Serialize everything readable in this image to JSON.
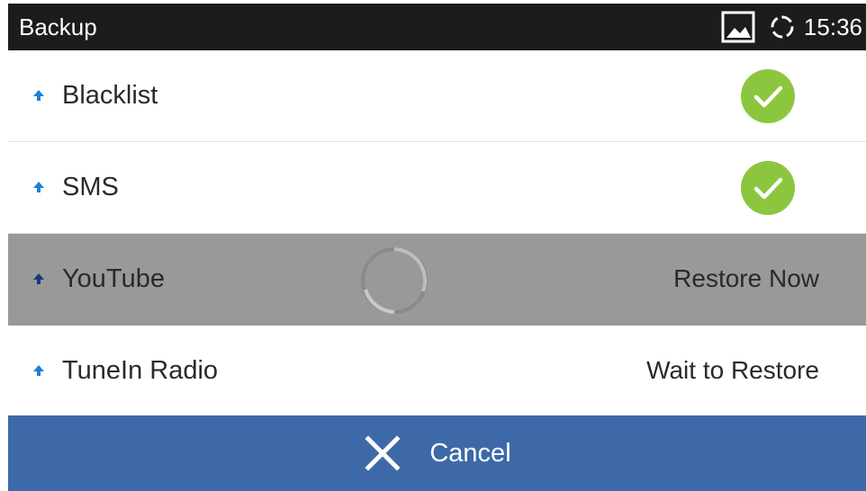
{
  "statusbar": {
    "title": "Backup",
    "time": "15:36",
    "icons": [
      "image-icon",
      "sync-icon"
    ]
  },
  "items": [
    {
      "label": "Blacklist",
      "state": "done",
      "icon": "check-circle-icon"
    },
    {
      "label": "SMS",
      "state": "done",
      "icon": "check-circle-icon"
    },
    {
      "label": "YouTube",
      "state": "in-progress",
      "status": "Restore Now",
      "icon": "loading-spinner-icon"
    },
    {
      "label": "TuneIn Radio",
      "state": "pending",
      "status": "Wait to Restore"
    }
  ],
  "cancel": {
    "label": "Cancel",
    "icon": "close-icon"
  },
  "colors": {
    "statusbar": "#1c1c1c",
    "active_row": "#999999",
    "check": "#8cc63f",
    "arrow": "#1e7fd8",
    "cancel_bar": "#3d69a8"
  }
}
